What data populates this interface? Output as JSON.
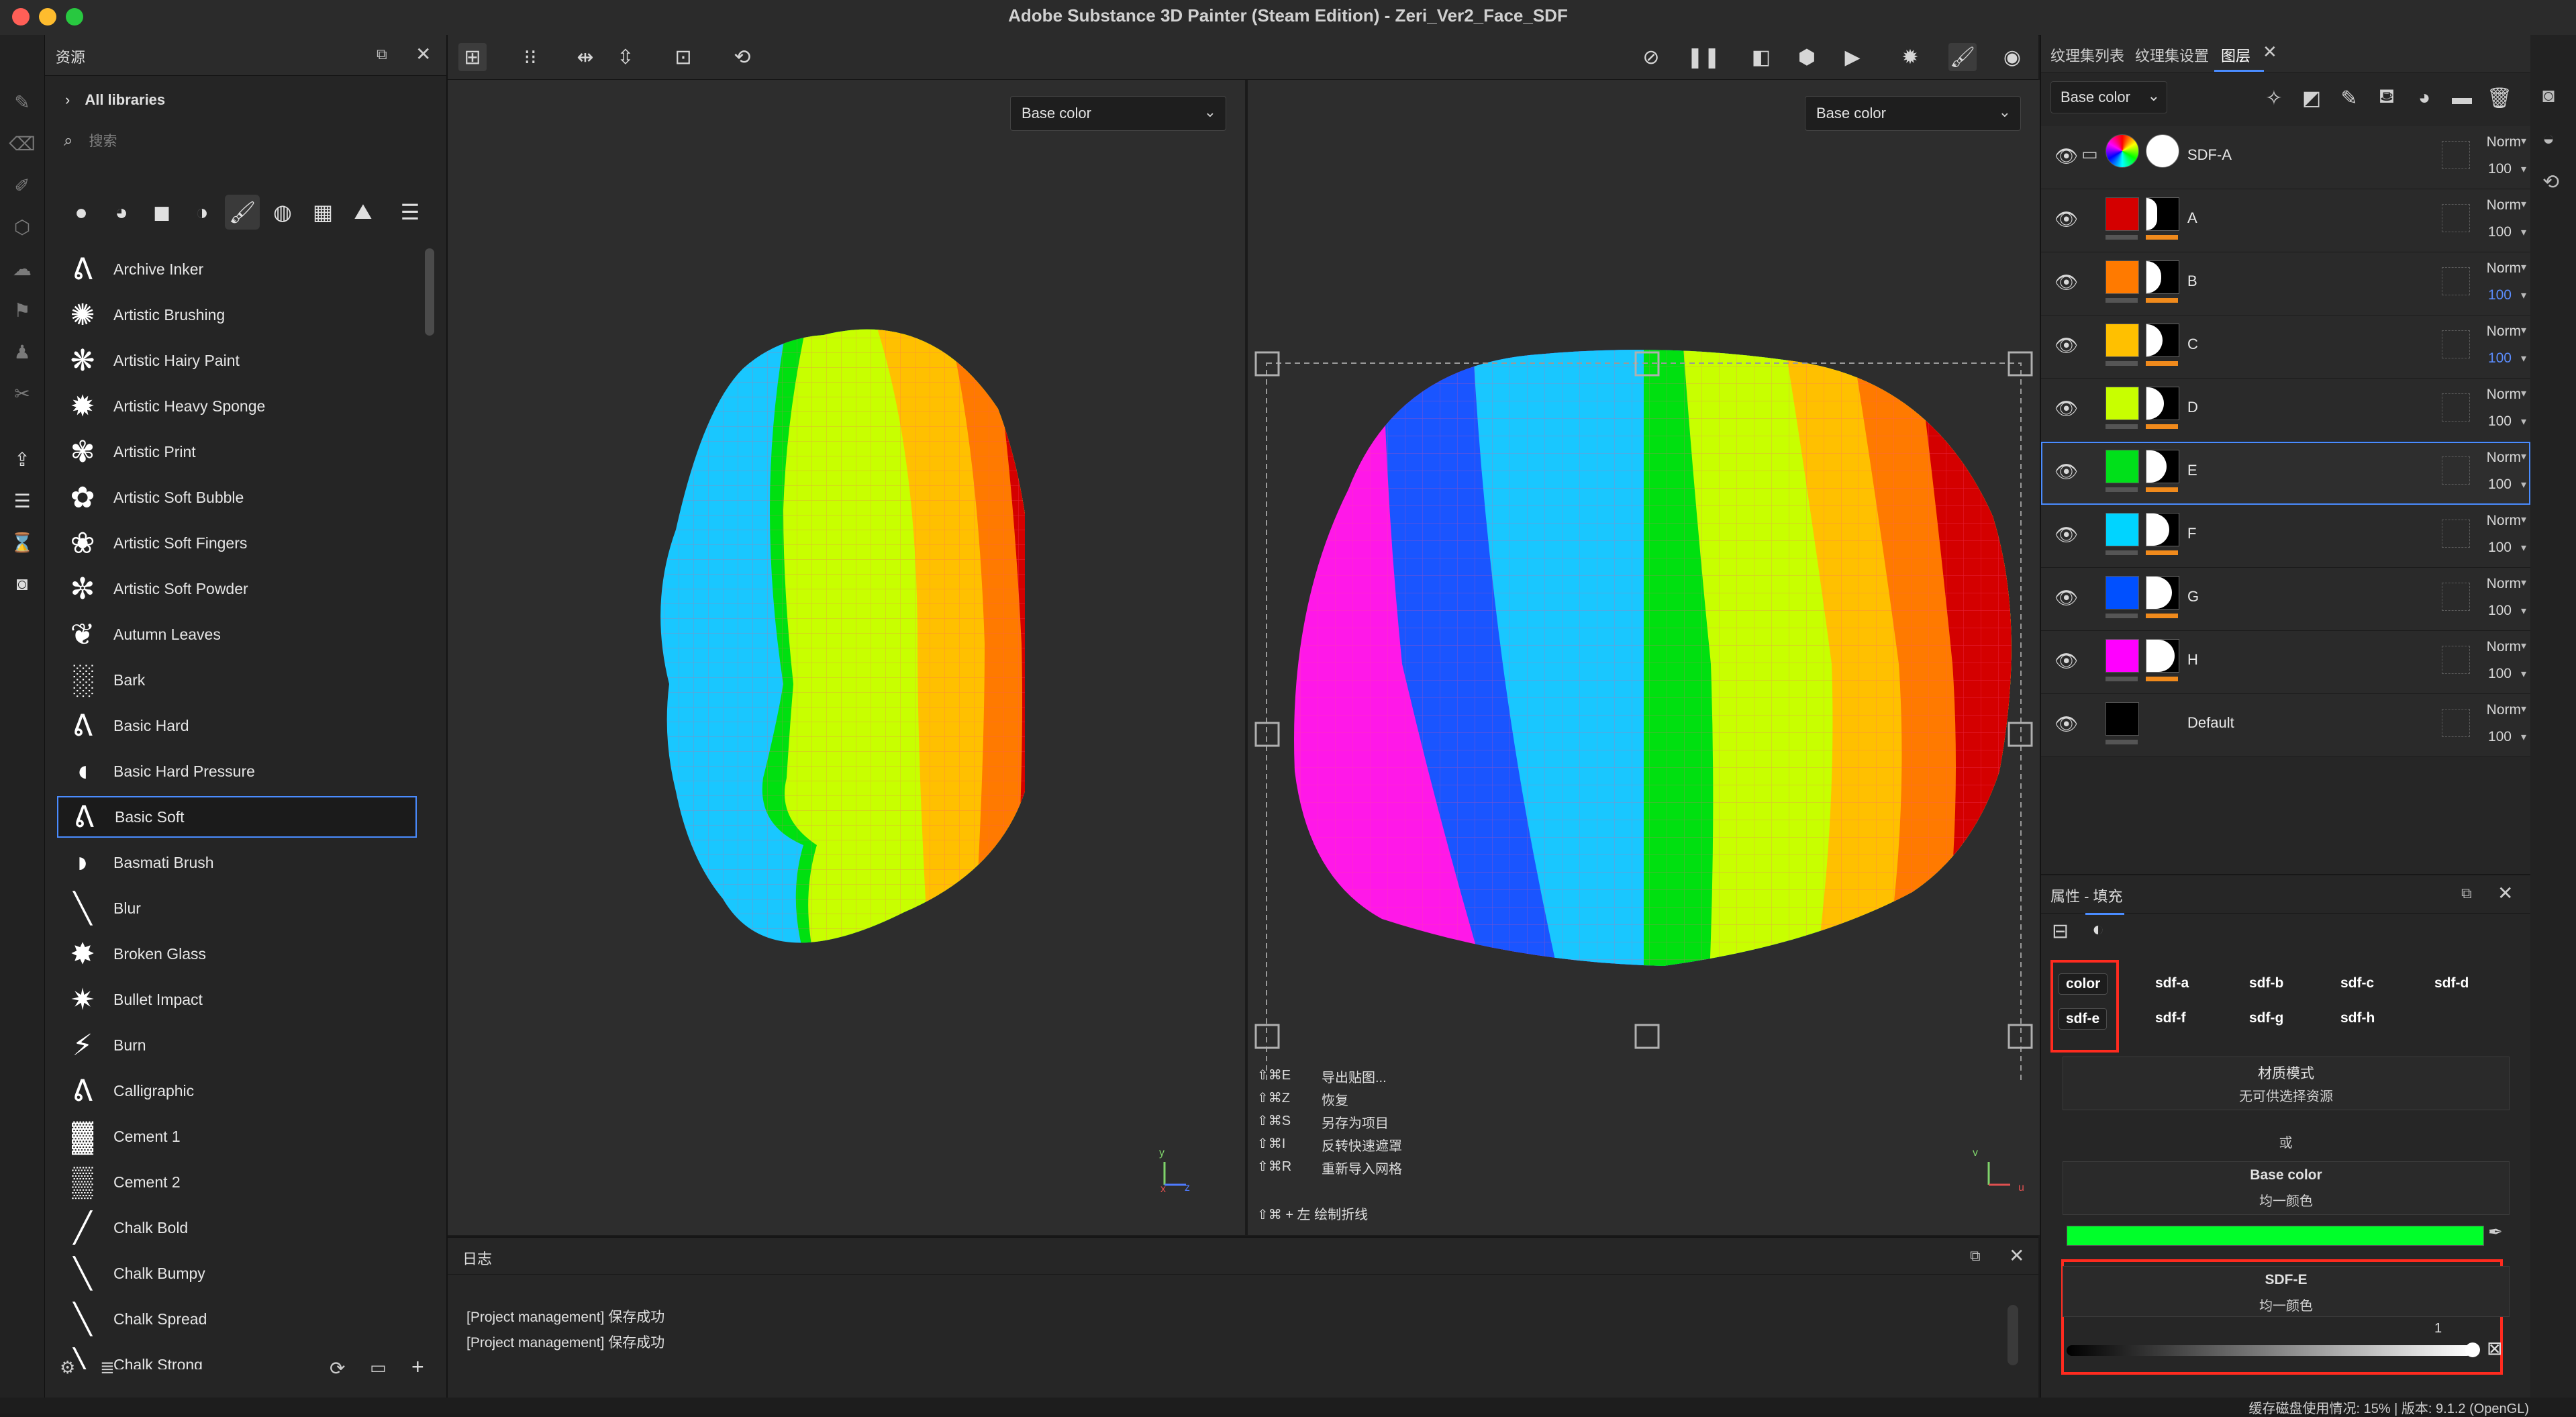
{
  "window": {
    "title": "Adobe Substance 3D Painter (Steam Edition) - Zeri_Ver2_Face_SDF"
  },
  "assets": {
    "panel_title": "资源",
    "library": "All libraries",
    "search_placeholder": "搜索",
    "brushes": [
      "Archive Inker",
      "Artistic Brushing",
      "Artistic Hairy Paint",
      "Artistic Heavy Sponge",
      "Artistic Print",
      "Artistic Soft Bubble",
      "Artistic Soft Fingers",
      "Artistic Soft Powder",
      "Autumn Leaves",
      "Bark",
      "Basic Hard",
      "Basic Hard Pressure",
      "Basic Soft",
      "Basmati Brush",
      "Blur",
      "Broken Glass",
      "Bullet Impact",
      "Burn",
      "Calligraphic",
      "Cement 1",
      "Cement 2",
      "Chalk Bold",
      "Chalk Bumpy",
      "Chalk Spread",
      "Chalk Strong"
    ],
    "selected_brush": "Basic Soft"
  },
  "viewport": {
    "left_channel": "Base color",
    "right_channel": "Base color",
    "axis_left": {
      "x": "x",
      "y": "y",
      "z": "z"
    },
    "axis_right": {
      "v": "v",
      "u": "u"
    },
    "shortcuts": [
      {
        "key": "⇧⌘E",
        "label": "导出贴图..."
      },
      {
        "key": "⇧⌘Z",
        "label": "恢复"
      },
      {
        "key": "⇧⌘S",
        "label": "另存为项目"
      },
      {
        "key": "⇧⌘I",
        "label": "反转快速遮罩"
      },
      {
        "key": "⇧⌘R",
        "label": "重新导入网格"
      }
    ],
    "shortcut_extra": "⇧⌘ + 左  绘制折线"
  },
  "log": {
    "title": "日志",
    "lines": [
      "[Project management] 保存成功",
      "[Project management] 保存成功"
    ]
  },
  "right": {
    "tabs": [
      "纹理集列表",
      "纹理集设置",
      "图层"
    ],
    "active_tab": "图层",
    "channel": "Base color",
    "layers": [
      {
        "name": "SDF-A",
        "blend": "Norm",
        "opacity": "100",
        "color": "folder",
        "mask": 0,
        "type": "folder"
      },
      {
        "name": "A",
        "blend": "Norm",
        "opacity": "100",
        "color": "#d40000",
        "mask": 16
      },
      {
        "name": "B",
        "blend": "Norm",
        "opacity": "100",
        "color": "#ff7a00",
        "mask": 22,
        "opacity_blue": true
      },
      {
        "name": "C",
        "blend": "Norm",
        "opacity": "100",
        "color": "#ffc000",
        "mask": 24,
        "opacity_blue": true
      },
      {
        "name": "D",
        "blend": "Norm",
        "opacity": "100",
        "color": "#c8ff00",
        "mask": 26
      },
      {
        "name": "E",
        "blend": "Norm",
        "opacity": "100",
        "color": "#00e01a",
        "mask": 30,
        "selected": true
      },
      {
        "name": "F",
        "blend": "Norm",
        "opacity": "100",
        "color": "#00d4ff",
        "mask": 34
      },
      {
        "name": "G",
        "blend": "Norm",
        "opacity": "100",
        "color": "#0050ff",
        "mask": 38
      },
      {
        "name": "H",
        "blend": "Norm",
        "opacity": "100",
        "color": "#ff00ff",
        "mask": 42
      },
      {
        "name": "Default",
        "blend": "Norm",
        "opacity": "100",
        "color": "#000000",
        "mask": -1
      }
    ],
    "properties": {
      "title": "属性 - 填充",
      "chips_row1": [
        "color",
        "sdf-a",
        "sdf-b",
        "sdf-c",
        "sdf-d"
      ],
      "chips_row2": [
        "sdf-e",
        "sdf-f",
        "sdf-g",
        "sdf-h"
      ],
      "material_mode": "材质模式",
      "no_resource": "无可供选择资源",
      "or": "或",
      "base_color_title": "Base color",
      "uniform": "均一颜色",
      "base_color_value": "#00ff2a",
      "sdf_title": "SDF-E",
      "sdf_uniform": "均一颜色",
      "sdf_value": "1"
    }
  },
  "status": {
    "text": "缓存磁盘使用情况:     15%  |  版本: 9.1.2 (OpenGL)"
  }
}
